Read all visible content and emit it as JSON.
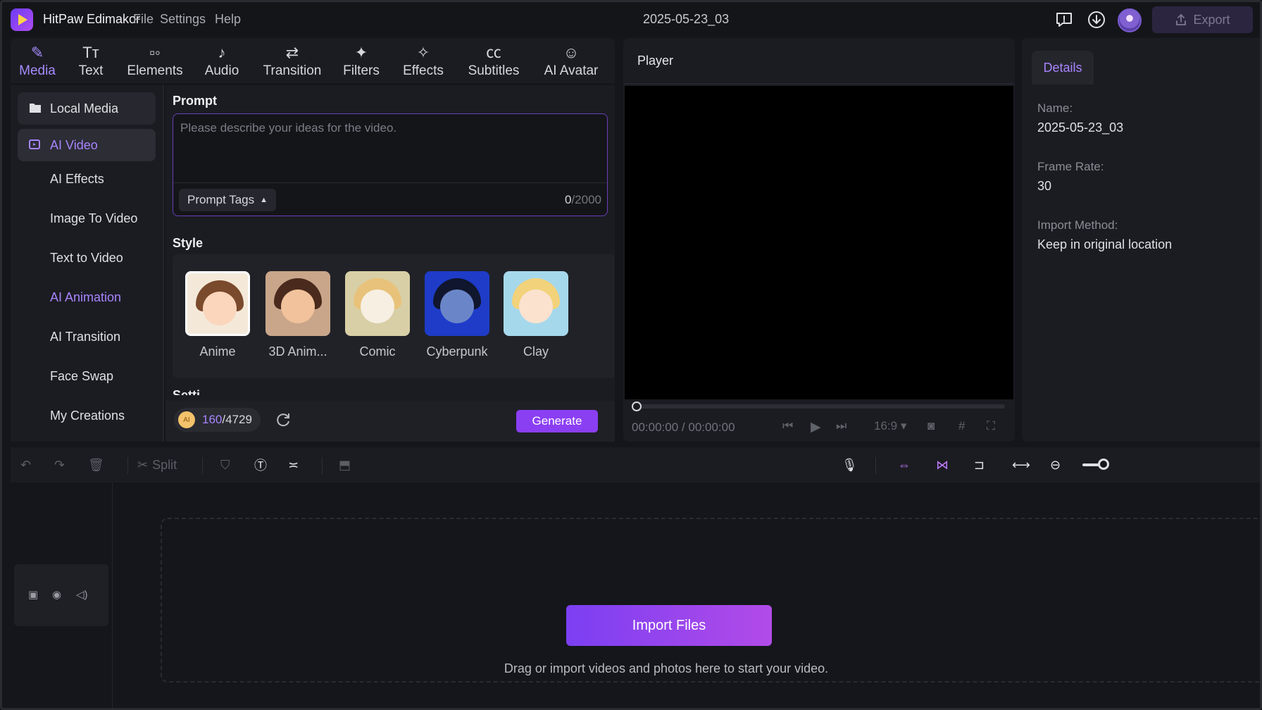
{
  "app": {
    "title": "HitPaw Edimakor",
    "project_name": "2025-05-23_03"
  },
  "menu": [
    "File",
    "Settings",
    "Help"
  ],
  "topbar": {
    "export_label": "Export"
  },
  "toolbar": {
    "tabs": [
      {
        "label": "Media",
        "icon": "media-icon",
        "active": true
      },
      {
        "label": "Text",
        "icon": "text-icon"
      },
      {
        "label": "Elements",
        "icon": "elements-icon"
      },
      {
        "label": "Audio",
        "icon": "audio-icon"
      },
      {
        "label": "Transition",
        "icon": "transition-icon"
      },
      {
        "label": "Filters",
        "icon": "filters-icon"
      },
      {
        "label": "Effects",
        "icon": "effects-icon"
      },
      {
        "label": "Subtitles",
        "icon": "subtitles-icon"
      },
      {
        "label": "AI Avatar",
        "icon": "ai-avatar-icon"
      }
    ]
  },
  "sidebar": {
    "items": [
      {
        "label": "Local Media"
      },
      {
        "label": "AI Video",
        "active": true
      },
      {
        "label": "AI Effects"
      },
      {
        "label": "Image To Video"
      },
      {
        "label": "Text to Video"
      },
      {
        "label": "AI Animation",
        "highlighted": true
      },
      {
        "label": "AI Transition"
      },
      {
        "label": "Face Swap"
      },
      {
        "label": "My Creations"
      }
    ]
  },
  "prompt": {
    "label": "Prompt",
    "placeholder": "Please describe your ideas for the video.",
    "tags_label": "Prompt Tags",
    "count_current": "0",
    "count_max": "/2000"
  },
  "style": {
    "label": "Style",
    "options": [
      "Anime",
      "3D Anim...",
      "Comic",
      "Cyberpunk",
      "Clay"
    ]
  },
  "settings_label": "Setti...",
  "credits": {
    "used": "160",
    "total": "/4729",
    "coin_label": "AI"
  },
  "generate_label": "Generate",
  "player": {
    "title": "Player",
    "time_current": "00:00:00",
    "time_total": "/ 00:00:00",
    "aspect_ratio": "16:9"
  },
  "details": {
    "tab": "Details",
    "fields": [
      {
        "label": "Name:",
        "value": "2025-05-23_03"
      },
      {
        "label": "Frame Rate:",
        "value": "30"
      },
      {
        "label": "Import Method:",
        "value": "Keep in original location"
      }
    ]
  },
  "timeline_toolbar": {
    "split_label": "Split"
  },
  "timeline": {
    "import_label": "Import Files",
    "hint": "Drag or import videos and photos here to start your video."
  },
  "colors": {
    "accent": "#8b3ff3",
    "accent_light": "#a884ff",
    "background": "#15161b",
    "panel": "#1b1c22"
  }
}
